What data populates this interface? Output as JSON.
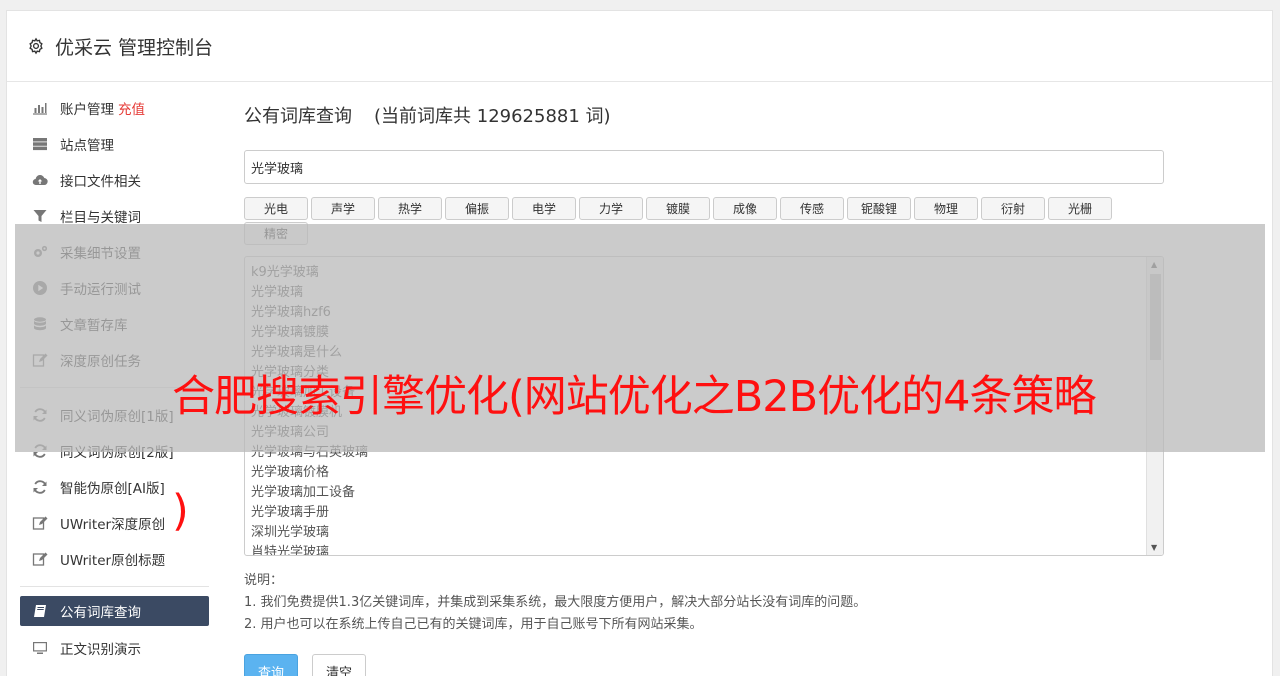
{
  "header": {
    "title": "优采云 管理控制台"
  },
  "sidebar": {
    "group1": [
      {
        "label": "账户管理",
        "extra": "充值",
        "icon": "bar-chart-icon"
      },
      {
        "label": "站点管理",
        "icon": "server-icon"
      },
      {
        "label": "接口文件相关",
        "icon": "cloud-upload-icon"
      },
      {
        "label": "栏目与关键词",
        "icon": "filter-icon"
      },
      {
        "label": "采集细节设置",
        "icon": "gears-icon"
      },
      {
        "label": "手动运行测试",
        "icon": "play-circle-icon"
      },
      {
        "label": "文章暂存库",
        "icon": "database-icon"
      },
      {
        "label": "深度原创任务",
        "icon": "edit-icon"
      }
    ],
    "group2": [
      {
        "label": "同义词伪原创[1版]",
        "icon": "refresh-icon"
      },
      {
        "label": "同义词伪原创[2版]",
        "icon": "refresh-icon"
      },
      {
        "label": "智能伪原创[AI版]",
        "icon": "refresh-icon"
      },
      {
        "label": "UWriter深度原创",
        "icon": "edit-icon"
      },
      {
        "label": "UWriter原创标题",
        "icon": "edit-icon"
      }
    ],
    "group3": [
      {
        "label": "公有词库查询",
        "icon": "book-icon",
        "active": true
      },
      {
        "label": "正文识别演示",
        "icon": "monitor-icon"
      }
    ]
  },
  "main": {
    "title": "公有词库查询",
    "count_text": "(当前词库共 129625881 词)",
    "search_value": "光学玻璃",
    "tags": [
      "光电",
      "声学",
      "热学",
      "偏振",
      "电学",
      "力学",
      "镀膜",
      "成像",
      "传感",
      "铌酸锂",
      "物理",
      "衍射",
      "光栅",
      "精密"
    ],
    "results": [
      "k9光学玻璃",
      "光学玻璃",
      "光学玻璃hzf6",
      "光学玻璃镀膜",
      "光学玻璃是什么",
      "光学玻璃分类",
      "光学玻璃加工设备",
      "光学玻璃镀膜机",
      "光学玻璃公司",
      "光学玻璃与石英玻璃",
      "光学玻璃价格",
      "光学玻璃加工设备",
      "光学玻璃手册",
      "深圳光学玻璃",
      "肖特光学玻璃"
    ],
    "notes_title": "说明：",
    "notes": [
      "1. 我们免费提供1.3亿关键词库，并集成到采集系统，最大限度方便用户，解决大部分站长没有词库的问题。",
      "2. 用户也可以在系统上传自己已有的关键词库，用于自己账号下所有网站采集。"
    ],
    "query_btn": "查询",
    "clear_btn": "清空"
  },
  "overlay": {
    "text": "合肥搜索引擎优化(网站优化之B2B优化的4条策略",
    "text_end": ")"
  },
  "colors": {
    "active_nav": "#3b4a63",
    "primary": "#5bb3f0",
    "accent_red": "#e53935",
    "overlay_text": "#ff1010"
  }
}
